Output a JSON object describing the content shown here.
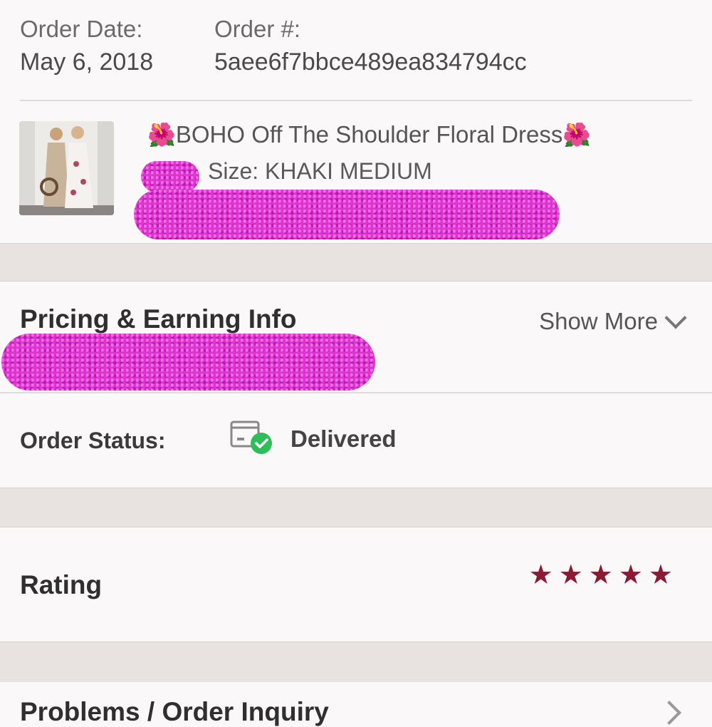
{
  "order": {
    "date_label": "Order Date:",
    "date_value": "May 6, 2018",
    "number_label": "Order #:",
    "number_value": "5aee6f7bbce489ea834794cc"
  },
  "product": {
    "title_emoji": "🌺",
    "title": "BOHO Off The Shoulder Floral Dress",
    "size": "Size: KHAKI MEDIUM"
  },
  "pricing": {
    "heading": "Pricing & Earning Info",
    "show_more": "Show More"
  },
  "status": {
    "label": "Order Status:",
    "value": "Delivered",
    "icon": "package-delivered-icon"
  },
  "rating": {
    "label": "Rating",
    "stars": 5,
    "star_color": "#8b1a34"
  },
  "problems": {
    "label": "Problems / Order Inquiry"
  },
  "colors": {
    "background": "#fbf8fa",
    "separator": "#e8e2e0",
    "redaction": "#dd33cf",
    "success": "#2ebd59"
  }
}
